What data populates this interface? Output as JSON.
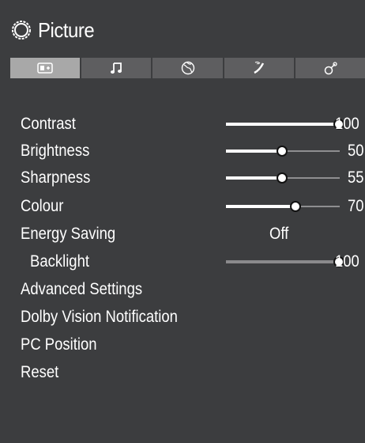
{
  "window": {
    "title": "Picture",
    "title_icon": "settings-ring-icon"
  },
  "tabs": [
    {
      "icon": "picture-icon",
      "active": true
    },
    {
      "icon": "music-note-icon",
      "active": false
    },
    {
      "icon": "globe-icon",
      "active": false
    },
    {
      "icon": "satellite-icon",
      "active": false
    },
    {
      "icon": "network-icon",
      "active": false
    }
  ],
  "settings": [
    {
      "label": "Contrast",
      "value": "100",
      "level": 1.0
    },
    {
      "label": "Brightness",
      "value": "50",
      "level": 0.5
    },
    {
      "label": "Sharpness",
      "value": "55",
      "level": 0.5
    },
    {
      "label": "Colour",
      "value": "70",
      "level": 0.62
    },
    {
      "label": "Energy Saving",
      "value": "Off"
    },
    {
      "label": "Backlight",
      "value": "100",
      "level": 1.0
    },
    {
      "label": "Advanced Settings"
    },
    {
      "label": "Dolby Vision Notification"
    },
    {
      "label": "PC Position"
    },
    {
      "label": "Reset"
    }
  ],
  "colors": {
    "background": "#3c3d3f",
    "tab_inactive": "#5e5e60",
    "tab_active": "#a8a8a8",
    "text": "#ffffff"
  }
}
